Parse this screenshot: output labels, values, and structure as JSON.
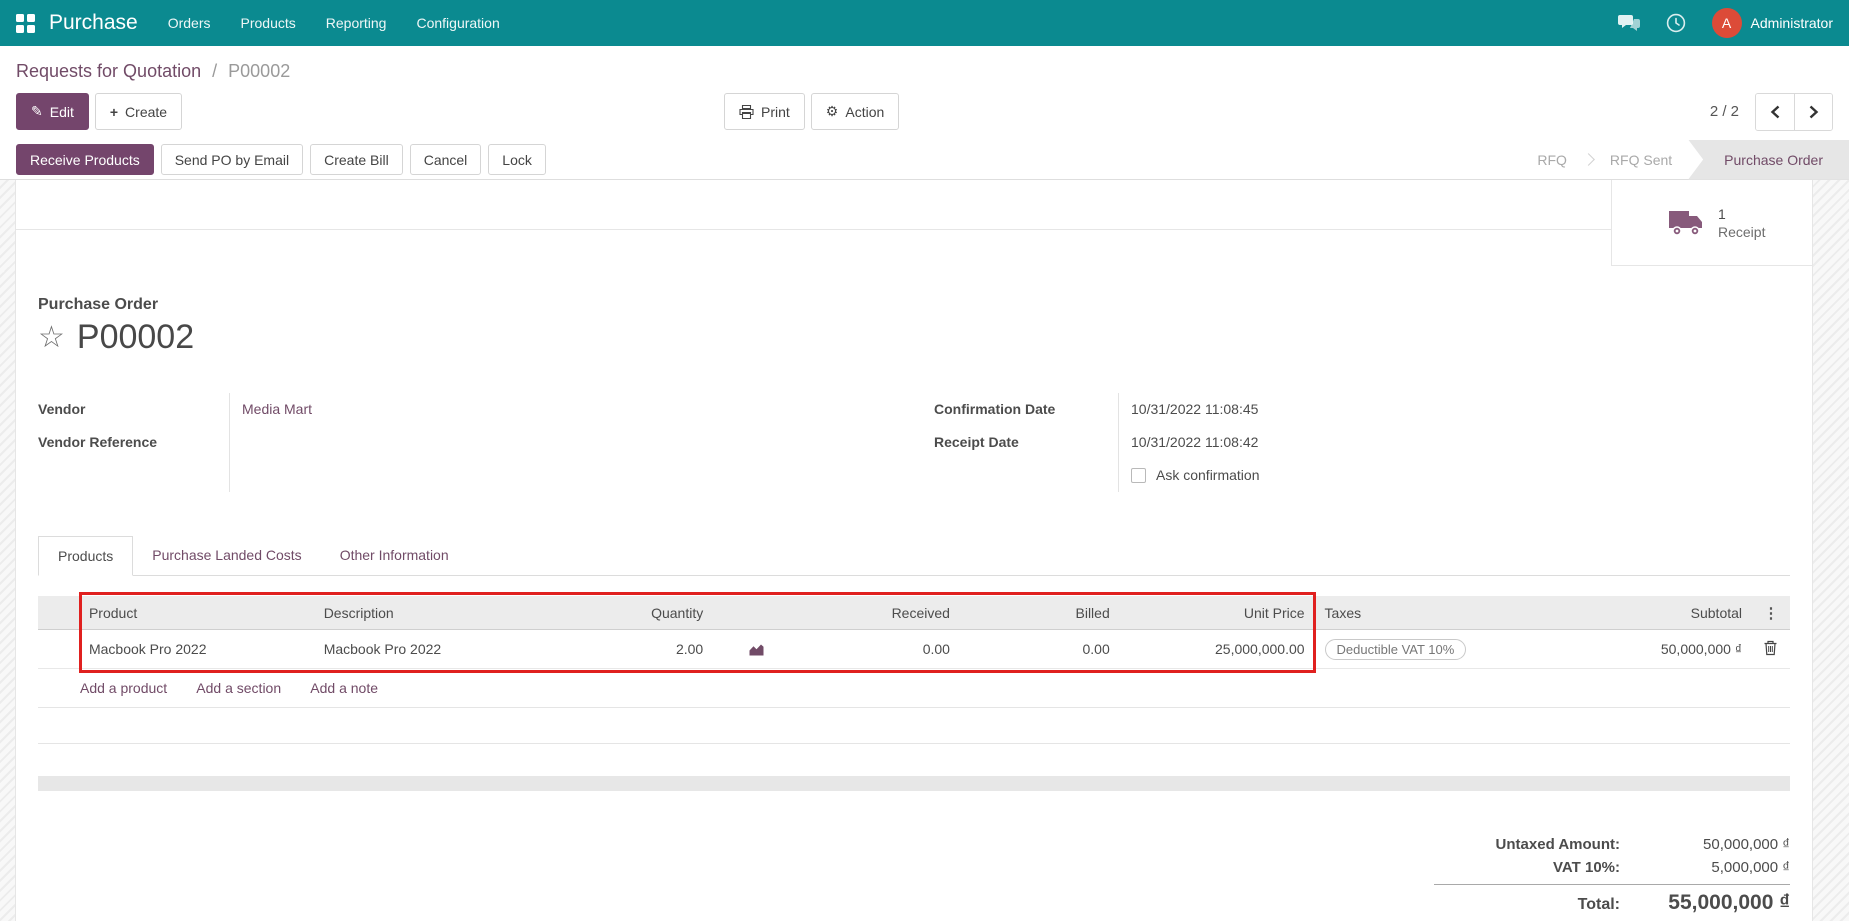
{
  "navbar": {
    "app_name": "Purchase",
    "menus": [
      "Orders",
      "Products",
      "Reporting",
      "Configuration"
    ],
    "user_initial": "A",
    "user_name": "Administrator"
  },
  "breadcrumb": {
    "parent": "Requests for Quotation",
    "separator": "/",
    "current": "P00002"
  },
  "control_panel": {
    "edit": "Edit",
    "create": "Create",
    "print": "Print",
    "action": "Action",
    "pager": "2 / 2"
  },
  "statusbar": {
    "receive_products": "Receive Products",
    "send_po_by_email": "Send PO by Email",
    "create_bill": "Create Bill",
    "cancel": "Cancel",
    "lock": "Lock",
    "steps": {
      "rfq": "RFQ",
      "rfq_sent": "RFQ Sent",
      "purchase_order": "Purchase Order"
    }
  },
  "button_box": {
    "receipt_count": "1",
    "receipt_label": "Receipt"
  },
  "sheet": {
    "doc_type": "Purchase Order",
    "name": "P00002",
    "vendor_label": "Vendor",
    "vendor_value": "Media Mart",
    "vendor_ref_label": "Vendor Reference",
    "vendor_ref_value": "",
    "confirmation_date_label": "Confirmation Date",
    "confirmation_date_value": "10/31/2022 11:08:45",
    "receipt_date_label": "Receipt Date",
    "receipt_date_value": "10/31/2022 11:08:42",
    "ask_confirmation_label": "Ask confirmation"
  },
  "tabs": {
    "products": "Products",
    "landed_costs": "Purchase Landed Costs",
    "other_info": "Other Information"
  },
  "lines": {
    "headers": {
      "product": "Product",
      "description": "Description",
      "quantity": "Quantity",
      "received": "Received",
      "billed": "Billed",
      "unit_price": "Unit Price",
      "taxes": "Taxes",
      "subtotal": "Subtotal",
      "menu": "⋮"
    },
    "row": {
      "product": "Macbook Pro 2022",
      "description": "Macbook Pro 2022",
      "quantity": "2.00",
      "received": "0.00",
      "billed": "0.00",
      "unit_price": "25,000,000.00",
      "tax": "Deductible VAT 10%",
      "subtotal": "50,000,000 ₫"
    },
    "add_product": "Add a product",
    "add_section": "Add a section",
    "add_note": "Add a note"
  },
  "totals": {
    "untaxed_label": "Untaxed Amount:",
    "untaxed_value": "50,000,000 ₫",
    "tax_label": "VAT 10%:",
    "tax_value": "5,000,000 ₫",
    "total_label": "Total:",
    "total_value": "55,000,000 ₫"
  },
  "colors": {
    "navbar": "#0b8a90",
    "primary": "#74456c",
    "annotation": "#e0201f",
    "avatar": "#dc4b38"
  }
}
